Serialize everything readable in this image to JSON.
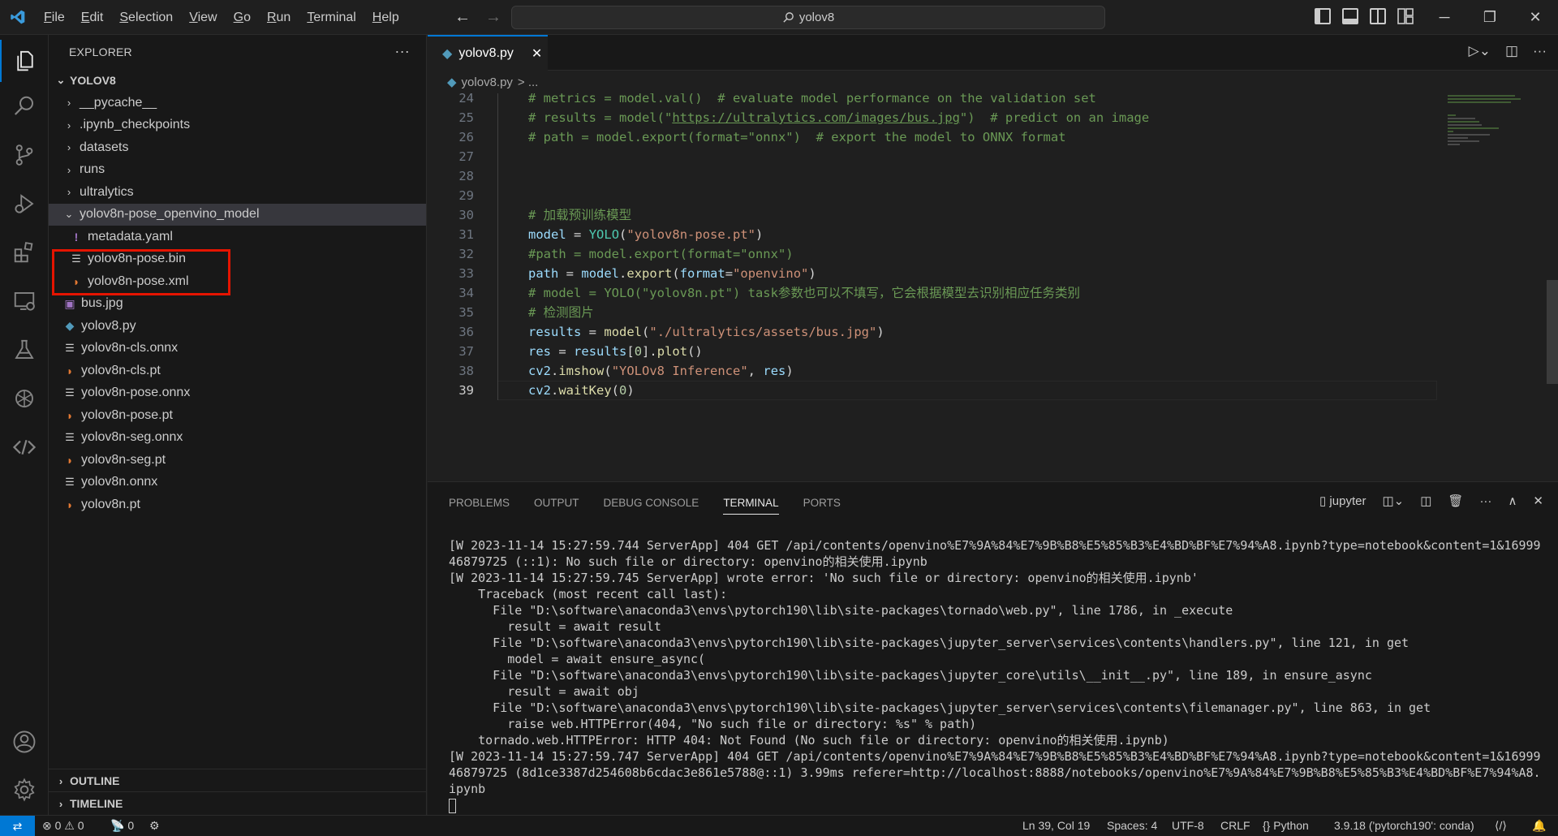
{
  "titlebar": {
    "menu": [
      "File",
      "Edit",
      "Selection",
      "View",
      "Go",
      "Run",
      "Terminal",
      "Help"
    ],
    "search_text": "yolov8"
  },
  "sidebar": {
    "title": "EXPLORER",
    "root": "YOLOV8",
    "items": [
      {
        "label": "__pycache__",
        "type": "folder"
      },
      {
        "label": ".ipynb_checkpoints",
        "type": "folder"
      },
      {
        "label": "datasets",
        "type": "folder"
      },
      {
        "label": "runs",
        "type": "folder"
      },
      {
        "label": "ultralytics",
        "type": "folder"
      },
      {
        "label": "yolov8n-pose_openvino_model",
        "type": "folder-open"
      },
      {
        "label": "metadata.yaml",
        "type": "yaml",
        "nested": true
      },
      {
        "label": "yolov8n-pose.bin",
        "type": "lines",
        "nested": true
      },
      {
        "label": "yolov8n-pose.xml",
        "type": "rss",
        "nested": true
      },
      {
        "label": "bus.jpg",
        "type": "image"
      },
      {
        "label": "yolov8.py",
        "type": "python"
      },
      {
        "label": "yolov8n-cls.onnx",
        "type": "lines"
      },
      {
        "label": "yolov8n-cls.pt",
        "type": "rss"
      },
      {
        "label": "yolov8n-pose.onnx",
        "type": "lines"
      },
      {
        "label": "yolov8n-pose.pt",
        "type": "rss"
      },
      {
        "label": "yolov8n-seg.onnx",
        "type": "lines"
      },
      {
        "label": "yolov8n-seg.pt",
        "type": "rss"
      },
      {
        "label": "yolov8n.onnx",
        "type": "lines"
      },
      {
        "label": "yolov8n.pt",
        "type": "rss"
      }
    ],
    "outline": "OUTLINE",
    "timeline": "TIMELINE"
  },
  "editor": {
    "tab_label": "yolov8.py",
    "breadcrumb_file": "yolov8.py",
    "breadcrumb_rest": "> ...",
    "current_line": 39,
    "lines": [
      {
        "n": "24",
        "t": "# metrics = model.val()  # evaluate model performance on the validation set",
        "c": "c-cm"
      },
      {
        "n": "25",
        "t": "# results = model(\"https://ultralytics.com/images/bus.jpg\")  # predict on an image",
        "c": "c-cm"
      },
      {
        "n": "26",
        "t": "# path = model.export(format=\"onnx\")  # export the model to ONNX format",
        "c": "c-cm"
      },
      {
        "n": "27",
        "t": "",
        "c": ""
      },
      {
        "n": "28",
        "t": "",
        "c": ""
      },
      {
        "n": "29",
        "t": "",
        "c": ""
      },
      {
        "n": "30",
        "t": "# 加载预训练模型",
        "c": "c-cm"
      },
      {
        "n": "31",
        "t": "model = YOLO(\"yolov8n-pose.pt\")",
        "c": "code"
      },
      {
        "n": "32",
        "t": "#path = model.export(format=\"onnx\")",
        "c": "c-cm"
      },
      {
        "n": "33",
        "t": "path = model.export(format=\"openvino\")",
        "c": "code"
      },
      {
        "n": "34",
        "t": "# model = YOLO(\"yolov8n.pt\") task参数也可以不填写，它会根据模型去识别相应任务类别",
        "c": "c-cm"
      },
      {
        "n": "35",
        "t": "# 检测图片",
        "c": "c-cm"
      },
      {
        "n": "36",
        "t": "results = model(\"./ultralytics/assets/bus.jpg\")",
        "c": "code"
      },
      {
        "n": "37",
        "t": "res = results[0].plot()",
        "c": "code"
      },
      {
        "n": "38",
        "t": "cv2.imshow(\"YOLOv8 Inference\", res)",
        "c": "code"
      },
      {
        "n": "39",
        "t": "cv2.waitKey(0)",
        "c": "code"
      }
    ]
  },
  "panel": {
    "tabs": [
      "PROBLEMS",
      "OUTPUT",
      "DEBUG CONSOLE",
      "TERMINAL",
      "PORTS"
    ],
    "active_tab": "TERMINAL",
    "terminal_name": "jupyter",
    "terminal_lines": [
      "[W 2023-11-14 15:27:59.744 ServerApp] 404 GET /api/contents/openvino%E7%9A%84%E7%9B%B8%E5%85%B3%E4%BD%BF%E7%94%A8.ipynb?type=notebook&content=1&16999",
      "46879725 (::1): No such file or directory: openvino的相关使用.ipynb",
      "[W 2023-11-14 15:27:59.745 ServerApp] wrote error: 'No such file or directory: openvino的相关使用.ipynb'",
      "    Traceback (most recent call last):",
      "      File \"D:\\software\\anaconda3\\envs\\pytorch190\\lib\\site-packages\\tornado\\web.py\", line 1786, in _execute",
      "        result = await result",
      "      File \"D:\\software\\anaconda3\\envs\\pytorch190\\lib\\site-packages\\jupyter_server\\services\\contents\\handlers.py\", line 121, in get",
      "        model = await ensure_async(",
      "      File \"D:\\software\\anaconda3\\envs\\pytorch190\\lib\\site-packages\\jupyter_core\\utils\\__init__.py\", line 189, in ensure_async",
      "        result = await obj",
      "      File \"D:\\software\\anaconda3\\envs\\pytorch190\\lib\\site-packages\\jupyter_server\\services\\contents\\filemanager.py\", line 863, in get",
      "        raise web.HTTPError(404, \"No such file or directory: %s\" % path)",
      "    tornado.web.HTTPError: HTTP 404: Not Found (No such file or directory: openvino的相关使用.ipynb)",
      "[W 2023-11-14 15:27:59.747 ServerApp] 404 GET /api/contents/openvino%E7%9A%84%E7%9B%B8%E5%85%B3%E4%BD%BF%E7%94%A8.ipynb?type=notebook&content=1&16999",
      "46879725 (8d1ce3387d254608b6cdac3e861e5788@::1) 3.99ms referer=http://localhost:8888/notebooks/openvino%E7%9A%84%E7%9B%B8%E5%85%B3%E4%BD%BF%E7%94%A8.",
      "ipynb"
    ]
  },
  "statusbar": {
    "errors": "0",
    "warnings": "0",
    "ports": "0",
    "position": "Ln 39, Col 19",
    "spaces": "Spaces: 4",
    "encoding": "UTF-8",
    "eol": "CRLF",
    "language": "Python",
    "interpreter": "3.9.18 ('pytorch190': conda)"
  },
  "colors": {
    "accent": "#0078d4",
    "highlight_box": "#e51400"
  }
}
